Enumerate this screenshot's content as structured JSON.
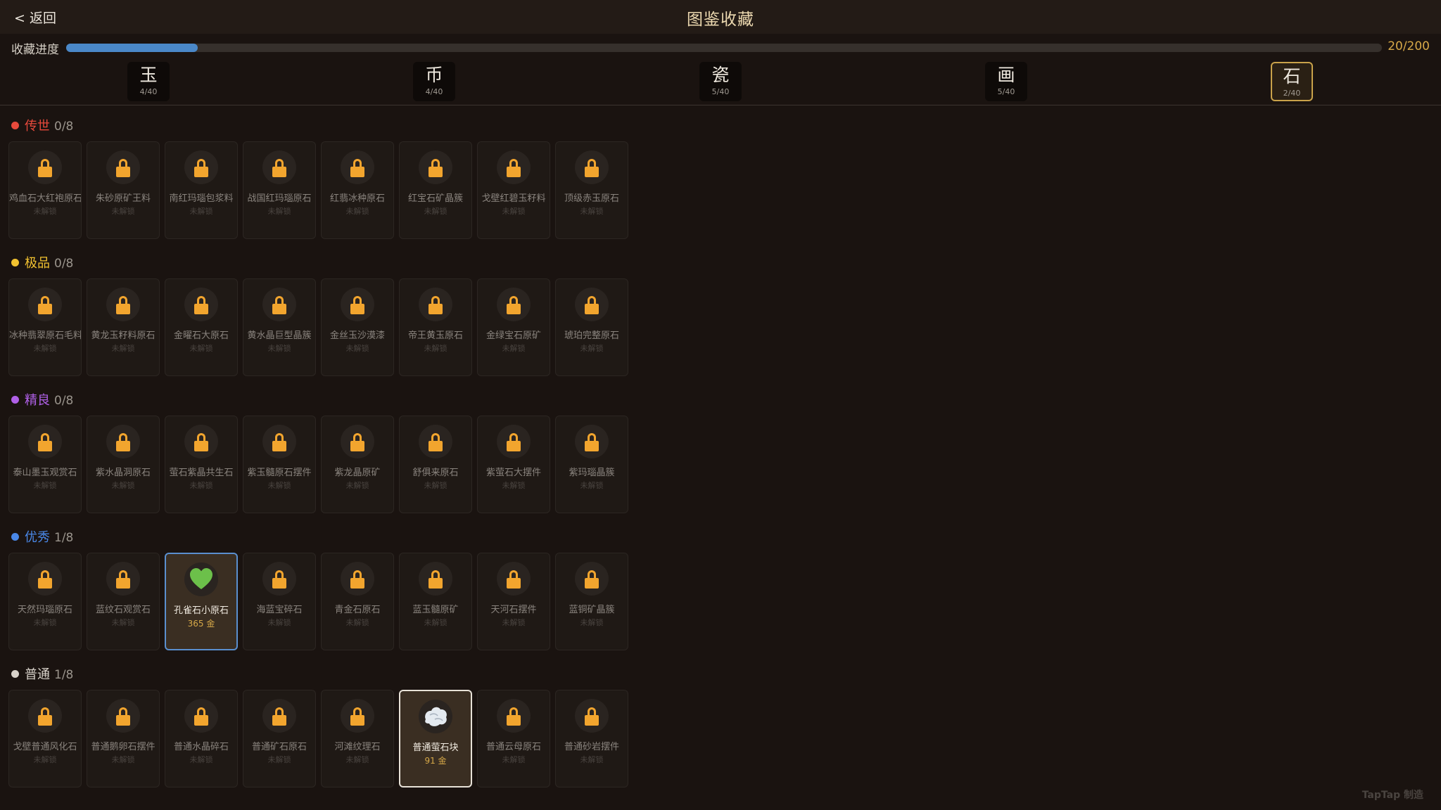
{
  "header": {
    "back_label": "< 返回",
    "title": "图鉴收藏"
  },
  "progress": {
    "label": "收藏进度",
    "count": "20/200",
    "fraction": 0.1
  },
  "categories": [
    {
      "char": "玉",
      "count": "4/40",
      "active": false
    },
    {
      "char": "币",
      "count": "4/40",
      "active": false
    },
    {
      "char": "瓷",
      "count": "5/40",
      "active": false
    },
    {
      "char": "画",
      "count": "5/40",
      "active": false
    },
    {
      "char": "石",
      "count": "2/40",
      "active": true
    }
  ],
  "sections": [
    {
      "name": "传世",
      "count": "0/8",
      "color": "#e84a3c",
      "items": [
        {
          "name": "鸡血石大红袍原石",
          "status": "未解锁",
          "locked": true
        },
        {
          "name": "朱砂原矿王料",
          "status": "未解锁",
          "locked": true
        },
        {
          "name": "南红玛瑙包浆料",
          "status": "未解锁",
          "locked": true
        },
        {
          "name": "战国红玛瑙原石",
          "status": "未解锁",
          "locked": true
        },
        {
          "name": "红翡冰种原石",
          "status": "未解锁",
          "locked": true
        },
        {
          "name": "红宝石矿晶簇",
          "status": "未解锁",
          "locked": true
        },
        {
          "name": "戈壁红碧玉籽料",
          "status": "未解锁",
          "locked": true
        },
        {
          "name": "顶级赤玉原石",
          "status": "未解锁",
          "locked": true
        }
      ]
    },
    {
      "name": "极品",
      "count": "0/8",
      "color": "#f2c230",
      "items": [
        {
          "name": "冰种翡翠原石毛料",
          "status": "未解锁",
          "locked": true
        },
        {
          "name": "黄龙玉籽料原石",
          "status": "未解锁",
          "locked": true
        },
        {
          "name": "金曜石大原石",
          "status": "未解锁",
          "locked": true
        },
        {
          "name": "黄水晶巨型晶簇",
          "status": "未解锁",
          "locked": true
        },
        {
          "name": "金丝玉沙漠漆",
          "status": "未解锁",
          "locked": true
        },
        {
          "name": "帝王黄玉原石",
          "status": "未解锁",
          "locked": true
        },
        {
          "name": "金绿宝石原矿",
          "status": "未解锁",
          "locked": true
        },
        {
          "name": "琥珀完整原石",
          "status": "未解锁",
          "locked": true
        }
      ]
    },
    {
      "name": "精良",
      "count": "0/8",
      "color": "#b060e8",
      "items": [
        {
          "name": "泰山墨玉观赏石",
          "status": "未解锁",
          "locked": true
        },
        {
          "name": "紫水晶洞原石",
          "status": "未解锁",
          "locked": true
        },
        {
          "name": "萤石紫晶共生石",
          "status": "未解锁",
          "locked": true
        },
        {
          "name": "紫玉髓原石摆件",
          "status": "未解锁",
          "locked": true
        },
        {
          "name": "紫龙晶原矿",
          "status": "未解锁",
          "locked": true
        },
        {
          "name": "舒俱来原石",
          "status": "未解锁",
          "locked": true
        },
        {
          "name": "紫萤石大摆件",
          "status": "未解锁",
          "locked": true
        },
        {
          "name": "紫玛瑙晶簇",
          "status": "未解锁",
          "locked": true
        }
      ]
    },
    {
      "name": "优秀",
      "count": "1/8",
      "color": "#4a88e8",
      "items": [
        {
          "name": "天然玛瑙原石",
          "status": "未解锁",
          "locked": true
        },
        {
          "name": "蓝纹石观赏石",
          "status": "未解锁",
          "locked": true
        },
        {
          "name": "孔雀石小原石",
          "status": "365 金",
          "locked": false,
          "icon": "heart-icon"
        },
        {
          "name": "海蓝宝碎石",
          "status": "未解锁",
          "locked": true
        },
        {
          "name": "青金石原石",
          "status": "未解锁",
          "locked": true
        },
        {
          "name": "蓝玉髓原矿",
          "status": "未解锁",
          "locked": true
        },
        {
          "name": "天河石摆件",
          "status": "未解锁",
          "locked": true
        },
        {
          "name": "蓝铜矿晶簇",
          "status": "未解锁",
          "locked": true
        }
      ]
    },
    {
      "name": "普通",
      "count": "1/8",
      "color": "#d8d2ca",
      "items": [
        {
          "name": "戈壁普通风化石",
          "status": "未解锁",
          "locked": true
        },
        {
          "name": "普通鹅卵石摆件",
          "status": "未解锁",
          "locked": true
        },
        {
          "name": "普通水晶碎石",
          "status": "未解锁",
          "locked": true
        },
        {
          "name": "普通矿石原石",
          "status": "未解锁",
          "locked": true
        },
        {
          "name": "河滩纹理石",
          "status": "未解锁",
          "locked": true
        },
        {
          "name": "普通萤石块",
          "status": "91 金",
          "locked": false,
          "icon": "rock-icon"
        },
        {
          "name": "普通云母原石",
          "status": "未解锁",
          "locked": true
        },
        {
          "name": "普通砂岩摆件",
          "status": "未解锁",
          "locked": true
        }
      ]
    }
  ],
  "watermark": "TapTap 制造"
}
